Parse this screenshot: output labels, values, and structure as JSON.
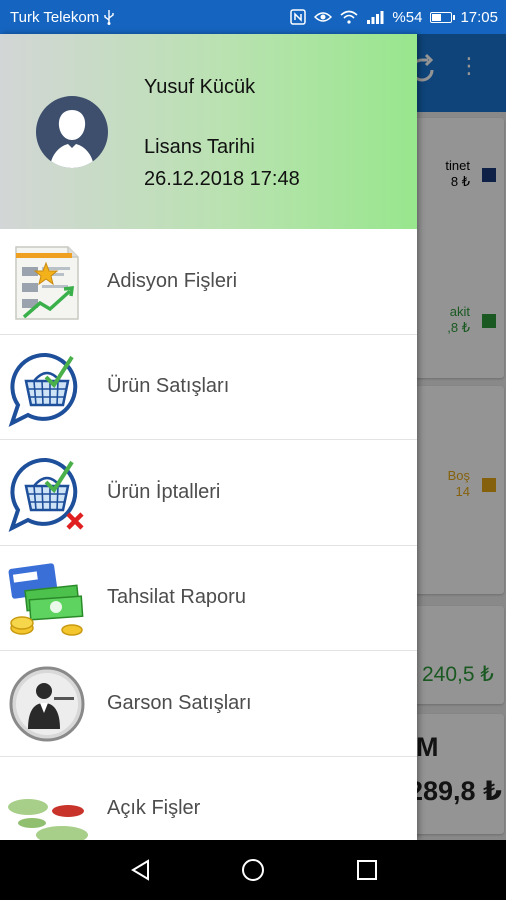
{
  "status_bar": {
    "carrier": "Turk Telekom",
    "battery_percent": "%54",
    "battery_level": 0.54,
    "time": "17:05",
    "icons": [
      "usb-icon",
      "nfc-icon",
      "eye-comfort-icon",
      "wifi-icon",
      "signal-icon",
      "battery-icon"
    ]
  },
  "background_app": {
    "legend": [
      {
        "label": "tinet",
        "value": "8 ₺",
        "color": "#1a3a7a"
      },
      {
        "label": "akit",
        "value": ",8 ₺",
        "color": "#2e9a3a"
      },
      {
        "label": "Boş",
        "value": "14",
        "color": "#e6a817"
      }
    ],
    "amount_green": "240,5 ₺",
    "amount_letter": "M",
    "amount_bold": "289,8 ₺"
  },
  "drawer": {
    "user_name": "Yusuf Kücük",
    "license_label": "Lisans Tarihi",
    "license_date": "26.12.2018 17:48",
    "menu": [
      {
        "label": "Adisyon Fişleri",
        "icon": "receipt-chart-icon"
      },
      {
        "label": "Ürün Satışları",
        "icon": "basket-check-icon"
      },
      {
        "label": "Ürün İptalleri",
        "icon": "basket-cancel-icon"
      },
      {
        "label": "Tahsilat Raporu",
        "icon": "money-card-icon"
      },
      {
        "label": "Garson Satışları",
        "icon": "waiter-icon"
      },
      {
        "label": "Açık Fişler",
        "icon": "open-tables-icon"
      }
    ]
  },
  "nav_bar": {
    "icons": [
      "back-icon",
      "home-icon",
      "recents-icon"
    ]
  }
}
